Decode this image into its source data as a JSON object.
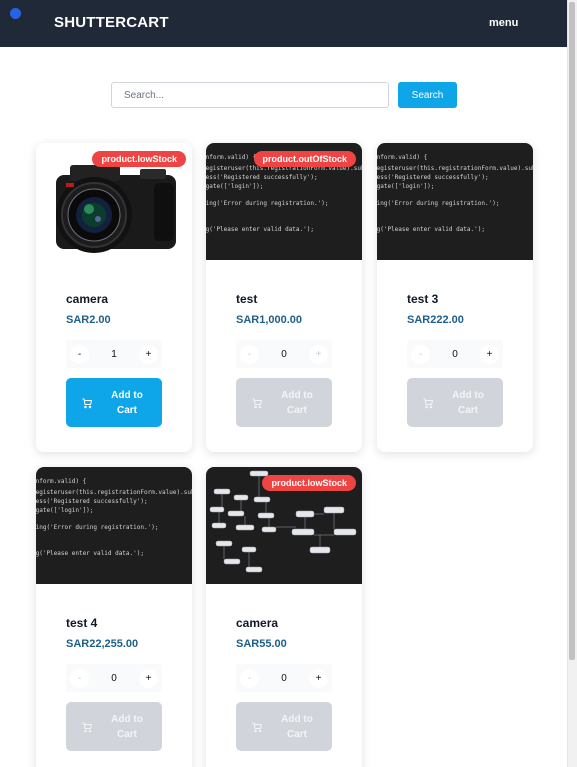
{
  "header": {
    "brand": "SHUTTERCART",
    "menu_label": "menu"
  },
  "search": {
    "placeholder": "Search...",
    "button_label": "Search"
  },
  "cart_label_line1": "Add to",
  "cart_label_line2": "Cart",
  "products": [
    {
      "name": "camera",
      "price": "SAR2.00",
      "qty": "1",
      "badge": "product.lowStock",
      "image": "camera-photo",
      "available": true
    },
    {
      "name": "test",
      "price": "SAR1,000.00",
      "qty": "0",
      "badge": "product.outOfStock",
      "image": "code-screenshot",
      "available": false
    },
    {
      "name": "test 3",
      "price": "SAR222.00",
      "qty": "0",
      "badge": "",
      "image": "code-screenshot",
      "available": false
    },
    {
      "name": "test 4",
      "price": "SAR22,255.00",
      "qty": "0",
      "badge": "",
      "image": "code-screenshot",
      "available": false
    },
    {
      "name": "camera",
      "price": "SAR55.00",
      "qty": "0",
      "badge": "product.lowStock",
      "image": "flowchart-diagram",
      "available": false
    }
  ],
  "code_snippet": [
    "onform.valid) {",
    "registeruser(this.registrationForm.value).sub",
    "cess('Registered successfully');",
    "igate(['login']);",
    "",
    "ning('Error during registration.');",
    "",
    "",
    "ng('Please enter valid data.');"
  ],
  "colors": {
    "navbar": "#1f2937",
    "accent": "#0ea5e9",
    "badge": "#ef4444",
    "price": "#1f5f8b",
    "disabled": "#d1d5db"
  },
  "icons": {
    "cart": "cart-icon",
    "plus": "+",
    "minus": "-"
  }
}
